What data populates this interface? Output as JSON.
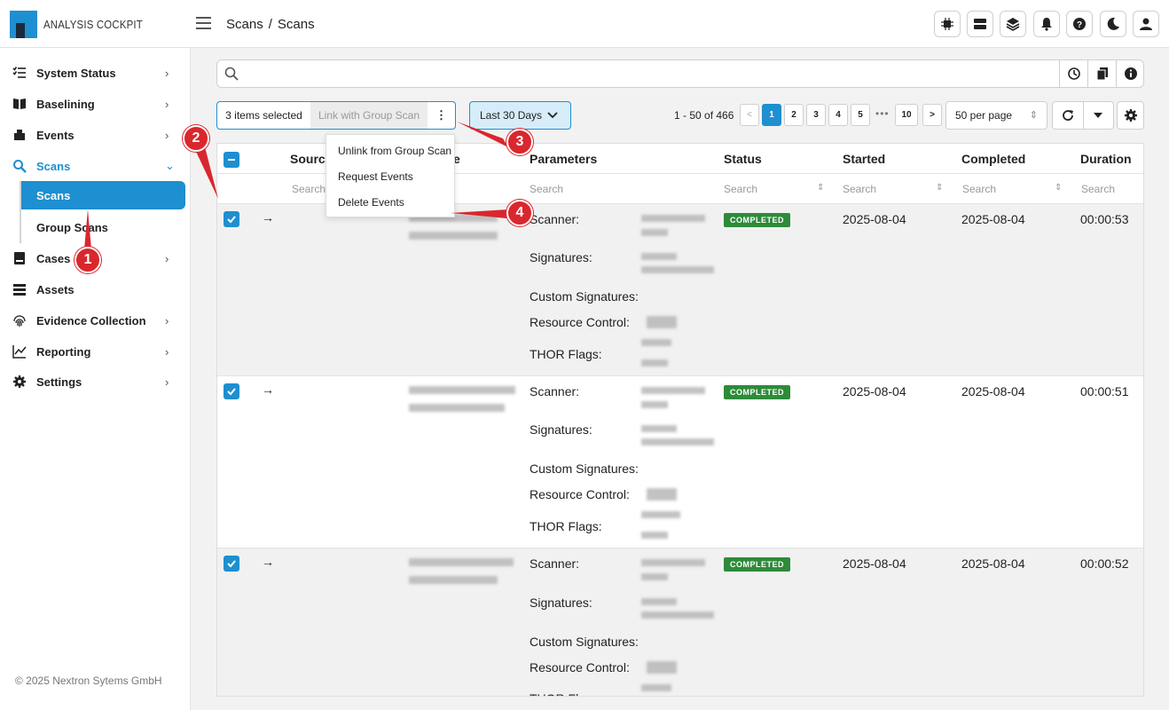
{
  "app": {
    "name": "ANALYSIS COCKPIT"
  },
  "breadcrumb": [
    "Scans",
    "/",
    "Scans"
  ],
  "header_icons": [
    "cpu-icon",
    "server-icon",
    "layers-icon",
    "bell-icon",
    "help-icon",
    "moon-icon",
    "user-icon"
  ],
  "sidebar": {
    "items": [
      {
        "label": "System Status",
        "icon": "list-check-icon",
        "chevron": "›"
      },
      {
        "label": "Baselining",
        "icon": "book-icon",
        "chevron": "›"
      },
      {
        "label": "Events",
        "icon": "box-icon",
        "chevron": "›"
      },
      {
        "label": "Scans",
        "icon": "search-icon",
        "chevron": "⌄"
      },
      {
        "label": "Cases",
        "icon": "case-icon",
        "chevron": "›"
      },
      {
        "label": "Assets",
        "icon": "assets-icon",
        "chevron": ""
      },
      {
        "label": "Evidence Collection",
        "icon": "fingerprint-icon",
        "chevron": "›"
      },
      {
        "label": "Reporting",
        "icon": "chart-icon",
        "chevron": "›"
      },
      {
        "label": "Settings",
        "icon": "gear-icon",
        "chevron": "›"
      }
    ],
    "sub_items": [
      {
        "label": "Scans",
        "active": true
      },
      {
        "label": "Group Scans",
        "active": false
      }
    ],
    "footer": "© 2025 Nextron Sytems GmbH"
  },
  "toolbar": {
    "selected": "3 items selected",
    "link_group": "Link with Group Scan",
    "kebab": "⋮",
    "date_range": "Last 30 Days",
    "page_info": "1 - 50 of 466",
    "pages": [
      "1",
      "2",
      "3",
      "4",
      "5",
      "10"
    ],
    "ellipsis": "•••",
    "per_page": "50 per page"
  },
  "menu": {
    "items": [
      "Unlink from Group Scan",
      "Request Events",
      "Delete Events"
    ]
  },
  "table": {
    "columns": [
      "Source",
      "e",
      "Parameters",
      "Status",
      "Started",
      "Completed",
      "Duration"
    ],
    "filter_placeholder": "Search",
    "param_labels": [
      "Scanner:",
      "Signatures:",
      "Custom Signatures:",
      "Resource Control:",
      "THOR Flags:"
    ],
    "rows": [
      {
        "status": "COMPLETED",
        "started": "2025-08-04",
        "completed": "2025-08-04",
        "duration": "00:00:53"
      },
      {
        "status": "COMPLETED",
        "started": "2025-08-04",
        "completed": "2025-08-04",
        "duration": "00:00:51"
      },
      {
        "status": "COMPLETED",
        "started": "2025-08-04",
        "completed": "2025-08-04",
        "duration": "00:00:52"
      }
    ]
  },
  "annotations": [
    "1",
    "2",
    "3",
    "4"
  ],
  "colors": {
    "accent": "#1e8fd0",
    "status_ok": "#2e8b3a",
    "annotation": "#d9272e"
  }
}
